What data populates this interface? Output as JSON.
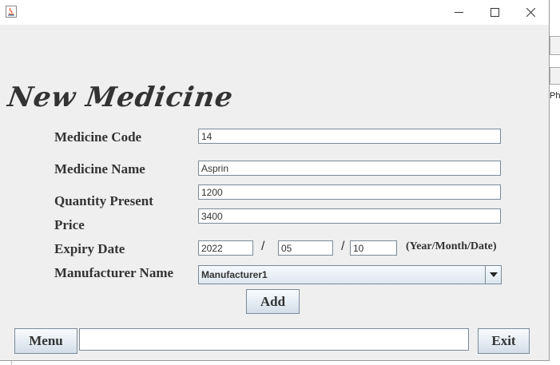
{
  "window": {
    "controls": {
      "minimize": "─",
      "maximize": "☐",
      "close": "✕"
    }
  },
  "form": {
    "heading": "New Medicine",
    "medicine_code": {
      "label": "Medicine Code",
      "value": "14"
    },
    "medicine_name": {
      "label": "Medicine Name",
      "value": "Asprin"
    },
    "quantity": {
      "label": "Quantity Present",
      "value": "1200"
    },
    "price": {
      "label": "Price",
      "value": "3400"
    },
    "expiry": {
      "label": "Expiry Date",
      "year": "2022",
      "month": "05",
      "day": "10",
      "separator": "/",
      "hint": "(Year/Month/Date)"
    },
    "manufacturer": {
      "label": "Manufacturer Name",
      "selected": "Manufacturer1"
    },
    "add_label": "Add"
  },
  "footer": {
    "menu_label": "Menu",
    "status_text": "",
    "exit_label": "Exit"
  },
  "background_window": {
    "partial_text": "Pha"
  },
  "colors": {
    "window_bg": "#efefef",
    "heading": "#333333",
    "field_border": "#7a8a99"
  }
}
